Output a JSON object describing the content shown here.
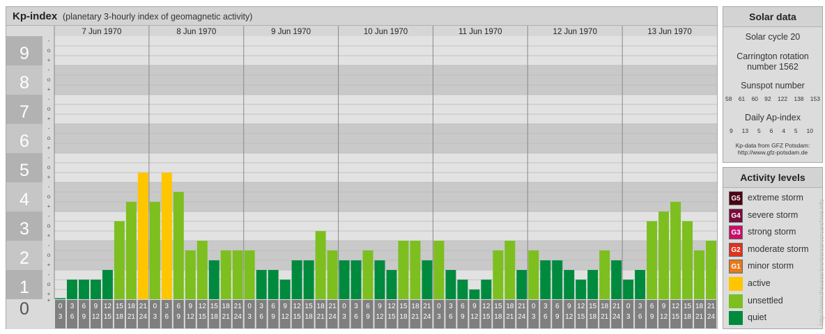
{
  "header": {
    "title": "Kp-index",
    "subtitle": "(planetary 3-hourly index of geomagnetic activity)"
  },
  "chart_data": {
    "type": "bar",
    "title": "Kp-index",
    "subtitle": "(planetary 3-hourly index of geomagnetic activity)",
    "ylim": [
      0,
      9
    ],
    "y_major_labels": [
      "0",
      "1",
      "2",
      "3",
      "4",
      "5",
      "6",
      "7",
      "8",
      "9"
    ],
    "y_minor_labels": [
      "+",
      "o",
      "-"
    ],
    "days": [
      "7 Jun 1970",
      "8 Jun 1970",
      "9 Jun 1970",
      "10 Jun 1970",
      "11 Jun 1970",
      "12 Jun 1970",
      "13 Jun 1970"
    ],
    "x_start_labels": [
      "0",
      "3",
      "6",
      "9",
      "12",
      "15",
      "18",
      "21"
    ],
    "x_end_labels": [
      "3",
      "6",
      "9",
      "12",
      "15",
      "18",
      "21",
      "24"
    ],
    "values": [
      [
        0.0,
        0.67,
        0.67,
        0.67,
        1.0,
        2.67,
        3.33,
        4.33
      ],
      [
        3.33,
        4.33,
        3.67,
        1.67,
        2.0,
        1.33,
        1.67,
        1.67
      ],
      [
        1.67,
        1.0,
        1.0,
        0.67,
        1.33,
        1.33,
        2.33,
        1.67
      ],
      [
        1.33,
        1.33,
        1.67,
        1.33,
        1.0,
        2.0,
        2.0,
        1.33
      ],
      [
        2.0,
        1.0,
        0.67,
        0.33,
        0.67,
        1.67,
        2.0,
        1.0
      ],
      [
        1.67,
        1.33,
        1.33,
        1.0,
        0.67,
        1.0,
        1.67,
        1.33
      ],
      [
        0.67,
        1.0,
        2.67,
        3.0,
        3.33,
        2.67,
        1.67,
        2.0
      ]
    ],
    "colors": {
      "quiet": "#008a3e",
      "unsettled": "#7cbf1f",
      "active": "#ffc600"
    },
    "grid": true,
    "legend": "right"
  },
  "solar": {
    "title": "Solar data",
    "cycle": "Solar cycle 20",
    "carrington": "Carrington rotation number 1562",
    "sunspot_label": "Sunspot number",
    "sunspot": [
      "58",
      "61",
      "60",
      "92",
      "122",
      "138",
      "153"
    ],
    "ap_label": "Daily Ap-index",
    "ap": [
      "9",
      "13",
      "5",
      "6",
      "4",
      "5",
      "10"
    ],
    "source_line1": "Kp-data from GFZ Potsdam:",
    "source_line2": "http://www.gfz-potsdam.de"
  },
  "levels": {
    "title": "Activity levels",
    "items": [
      {
        "code": "G5",
        "label": "extreme storm",
        "color": "#4a0016"
      },
      {
        "code": "G4",
        "label": "severe storm",
        "color": "#7a0b3c"
      },
      {
        "code": "G3",
        "label": "strong storm",
        "color": "#c8106a"
      },
      {
        "code": "G2",
        "label": "moderate storm",
        "color": "#e0321e"
      },
      {
        "code": "G1",
        "label": "minor storm",
        "color": "#e8781a"
      },
      {
        "code": "",
        "label": "active",
        "color": "#ffc600"
      },
      {
        "code": "",
        "label": "unsettled",
        "color": "#7cbf1f"
      },
      {
        "code": "",
        "label": "quiet",
        "color": "#008a3e"
      }
    ]
  },
  "watermark": "http://www.theusesrbrsrbarsarcsrcarchive.info"
}
